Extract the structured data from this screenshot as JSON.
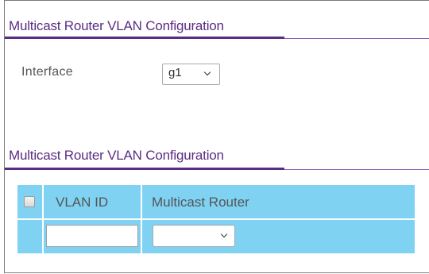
{
  "section1": {
    "title": "Multicast Router VLAN Configuration"
  },
  "interface": {
    "label": "Interface",
    "selected": "g1"
  },
  "section2": {
    "title": "Multicast Router VLAN Configuration"
  },
  "table": {
    "columns": [
      "VLAN ID",
      "Multicast Router"
    ],
    "new_row": {
      "vlan_id_value": "",
      "multicast_router_value": ""
    }
  },
  "colors": {
    "title_purple": "#5b2c83",
    "table_header_blue": "#7fd2f2"
  },
  "icons": {
    "select_arrow": "chevron-down-icon",
    "select_all": "checkbox-icon"
  }
}
